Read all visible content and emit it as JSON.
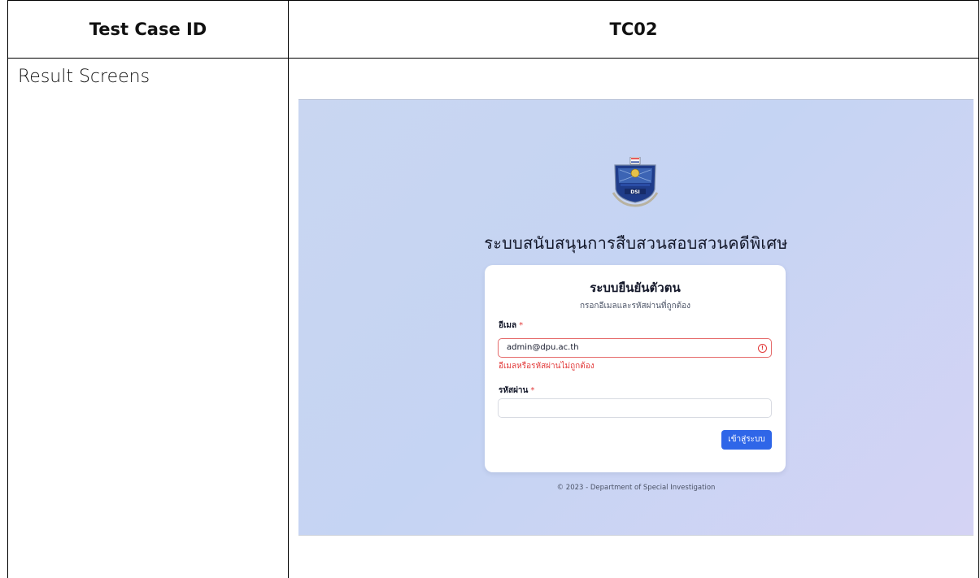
{
  "table": {
    "header_label": "Test Case ID",
    "header_value": "TC02",
    "row_label": "Result Screens"
  },
  "screenshot": {
    "site_title": "ระบบสนับสนุนการสืบสวนสอบสวนคดีพิเศษ",
    "logo_text": "DSI",
    "card": {
      "title": "ระบบยืนยันตัวตน",
      "subtitle": "กรอกอีเมลและรหัสผ่านที่ถูกต้อง",
      "email_label": "อีเมล",
      "email_value": "admin@dpu.ac.th",
      "email_error": "อีเมลหรือรหัสผ่านไม่ถูกต้อง",
      "password_label": "รหัสผ่าน",
      "password_value": "",
      "required_mark": "*",
      "submit_label": "เข้าสู่ระบบ"
    },
    "footer": "© 2023 - Department of Special Investigation"
  },
  "colors": {
    "accent": "#2f66e8",
    "error": "#e23a3a"
  }
}
